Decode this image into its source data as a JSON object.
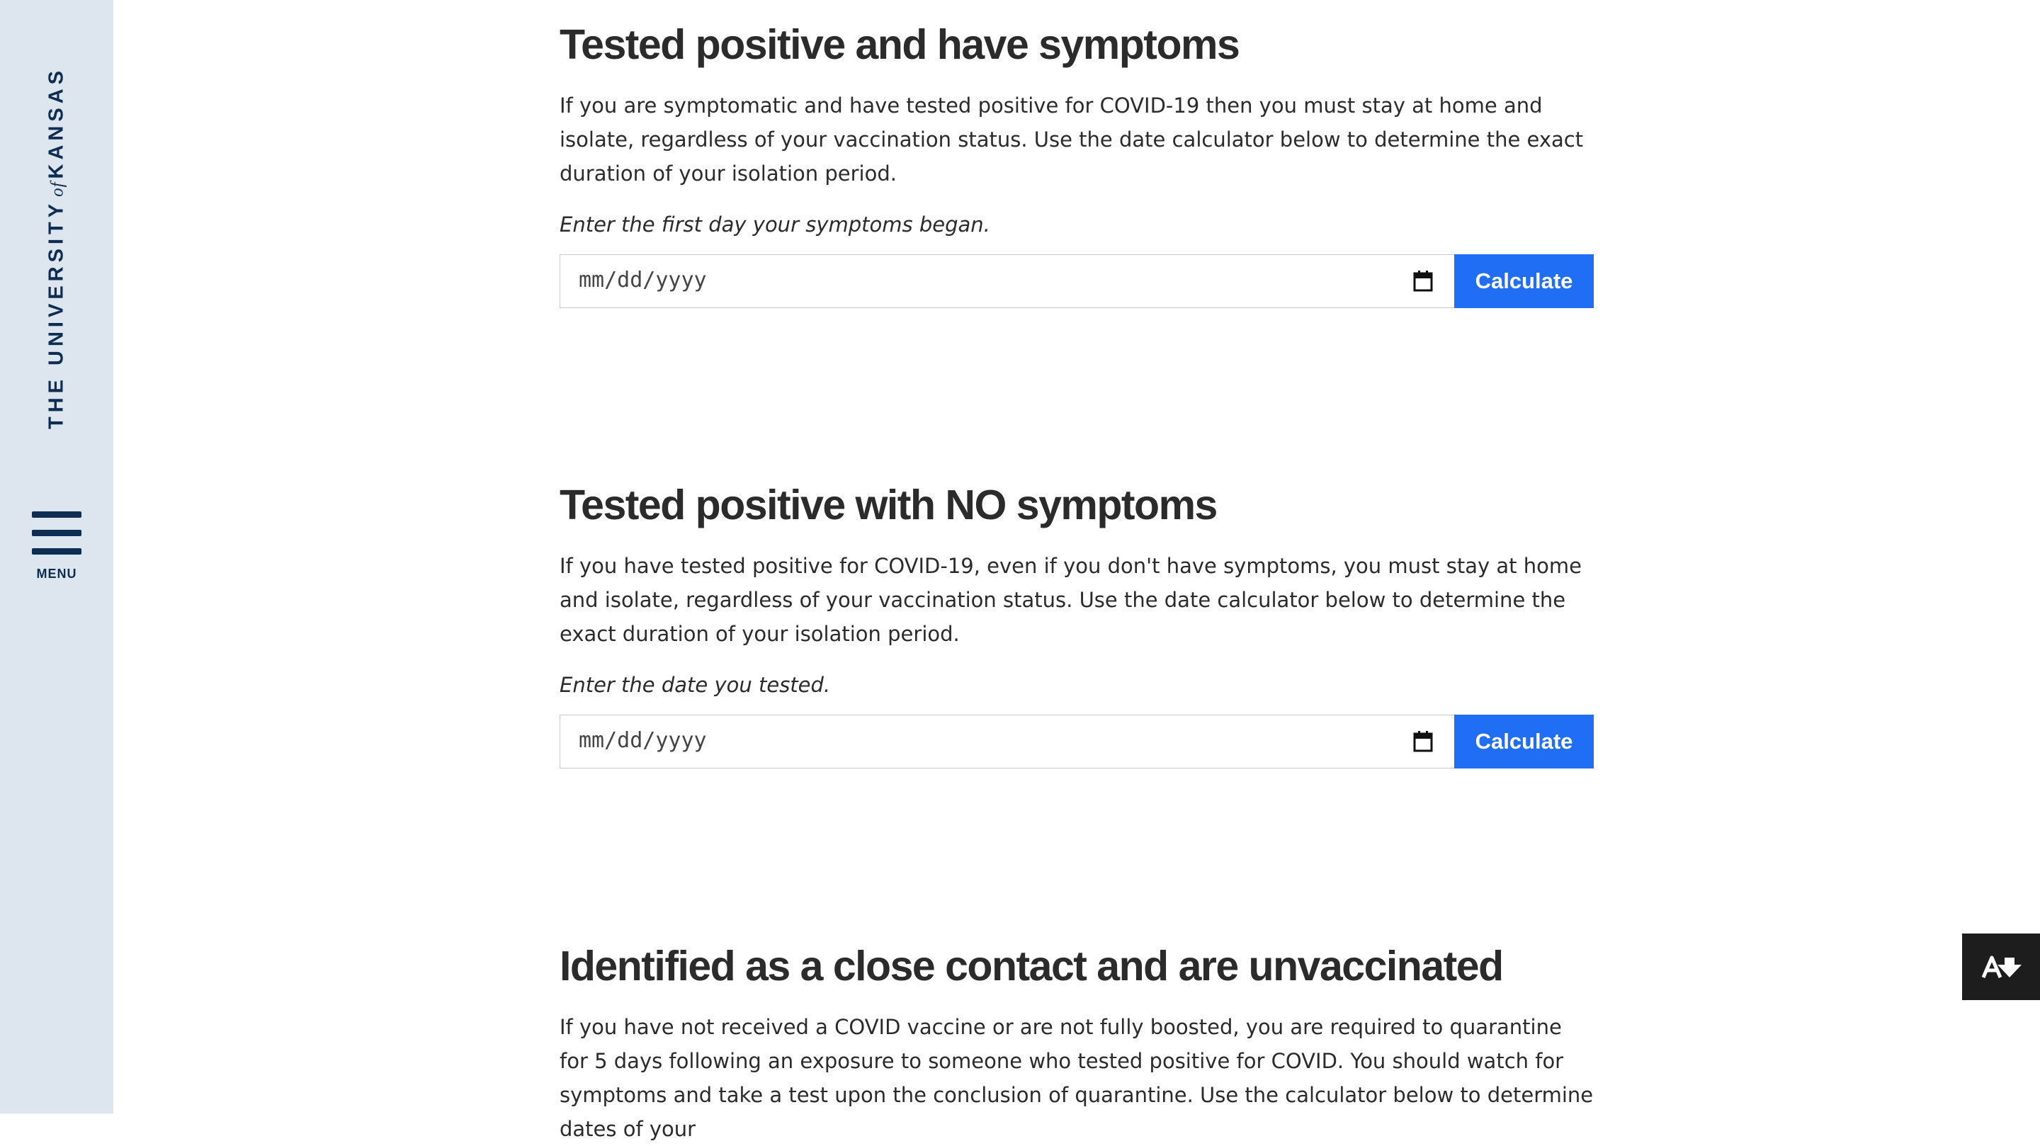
{
  "sidebar": {
    "logo": {
      "part1": "THE UNIVERSITY",
      "of": "of",
      "part2": "KANSAS"
    },
    "menu_label": "MENU"
  },
  "sections": [
    {
      "title": "Tested positive and have symptoms",
      "body": "If you are symptomatic and have tested positive for COVID-19 then you must stay at home and isolate, regardless of your vaccination status. Use the date calculator below to determine the exact duration of your isolation period.",
      "prompt": "Enter the first day your symptoms began.",
      "date_placeholder": "mm/dd/yyyy",
      "button_label": "Calculate"
    },
    {
      "title": "Tested positive with NO symptoms",
      "body": "If you have tested positive for COVID-19, even if you don't have symptoms, you must stay at home and isolate, regardless of your vaccination status. Use the date calculator below to determine the exact duration of your isolation period.",
      "prompt": "Enter the date you tested.",
      "date_placeholder": "mm/dd/yyyy",
      "button_label": "Calculate"
    },
    {
      "title": "Identified as a close contact and are unvaccinated",
      "body": "If you have not received a COVID vaccine or are not fully boosted, you are required to quarantine for 5 days following an exposure to someone who tested positive for COVID. You should watch for symptoms and take a test upon the conclusion of quarantine. Use the calculator below to determine dates of your"
    }
  ],
  "floating_button": {
    "icon": "accessibility-download-icon"
  },
  "colors": {
    "sidebar_bg": "#dde5ee",
    "brand_navy": "#0d2d52",
    "button_blue": "#1f6ef4",
    "text": "#2b2b2b"
  }
}
